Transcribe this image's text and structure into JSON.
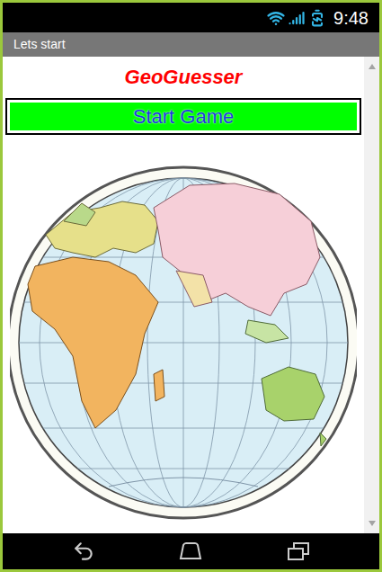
{
  "status_bar": {
    "time": "9:48"
  },
  "title_bar": {
    "title": "Lets start"
  },
  "heading": "GeoGuesser",
  "start_button": {
    "label": "Start Game"
  }
}
